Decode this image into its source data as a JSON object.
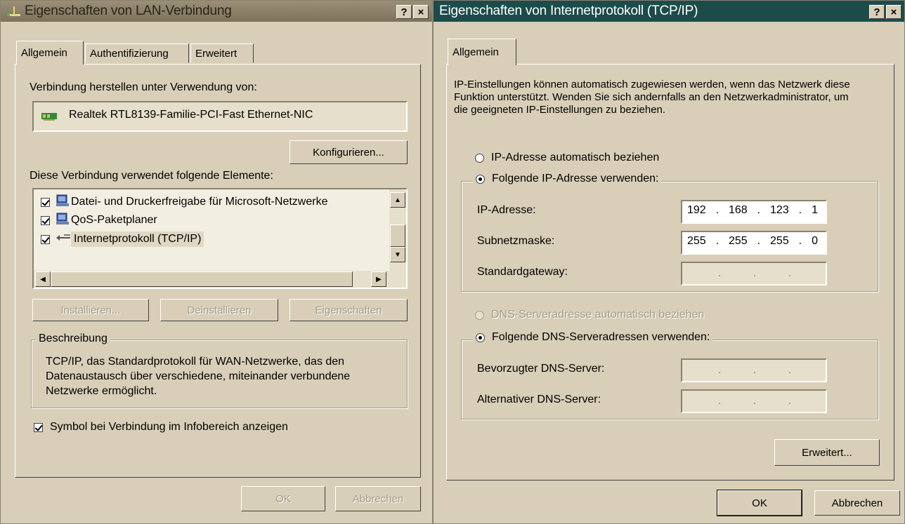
{
  "left": {
    "title": "Eigenschaften von LAN-Verbindung",
    "help": "?",
    "close": "×",
    "tabs": [
      "Allgemein",
      "Authentifizierung",
      "Erweitert"
    ],
    "connect_using_label": "Verbindung herstellen unter Verwendung von:",
    "adapter": "Realtek RTL8139-Familie-PCI-Fast Ethernet-NIC",
    "configure_button": "Konfigurieren...",
    "elements_label": "Diese Verbindung verwendet folgende Elemente:",
    "items": [
      {
        "label": "Datei- und Druckerfreigabe für Microsoft-Netzwerke",
        "checked": true,
        "icon": "network-computer-icon"
      },
      {
        "label": "QoS-Paketplaner",
        "checked": true,
        "icon": "network-computer-icon"
      },
      {
        "label": "Internetprotokoll (TCP/IP)",
        "checked": true,
        "icon": "protocol-icon"
      }
    ],
    "install_button": "Installieren...",
    "uninstall_button": "Deinstallieren",
    "properties_button": "Eigenschaften",
    "description_legend": "Beschreibung",
    "description_text": "TCP/IP, das Standardprotokoll für WAN-Netzwerke, das den Datenaustausch über verschiedene, miteinander verbundene Netzwerke ermöglicht.",
    "show_icon_label": "Symbol bei Verbindung im Infobereich anzeigen",
    "ok_button": "OK",
    "cancel_button": "Abbrechen"
  },
  "right": {
    "title": "Eigenschaften von Internetprotokoll (TCP/IP)",
    "help": "?",
    "close": "×",
    "tab": "Allgemein",
    "intro": "IP-Einstellungen können automatisch zugewiesen werden, wenn das Netzwerk diese Funktion unterstützt. Wenden Sie sich andernfalls an den Netzwerkadministrator, um die geeigneten IP-Einstellungen zu beziehen.",
    "ip_auto_label": "IP-Adresse automatisch beziehen",
    "ip_manual_label": "Folgende IP-Adresse verwenden:",
    "ip_address_label": "IP-Adresse:",
    "ip_address": [
      "192",
      "168",
      "123",
      "1"
    ],
    "subnet_label": "Subnetzmaske:",
    "subnet": [
      "255",
      "255",
      "255",
      "0"
    ],
    "gateway_label": "Standardgateway:",
    "dns_auto_label": "DNS-Serveradresse automatisch beziehen",
    "dns_manual_label": "Folgende DNS-Serveradressen verwenden:",
    "dns_preferred_label": "Bevorzugter DNS-Server:",
    "dns_alternate_label": "Alternativer DNS-Server:",
    "advanced_button": "Erweitert...",
    "ok_button": "OK",
    "cancel_button": "Abbrechen"
  },
  "colors": {
    "left_titlebar": "#8a7f66",
    "right_titlebar": "#1c4c4a",
    "dialog_face": "#d9cfb8"
  }
}
